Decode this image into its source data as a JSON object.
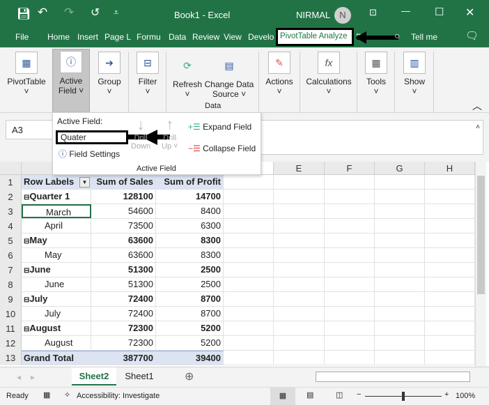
{
  "window": {
    "title": "Book1 - Excel",
    "user": "NIRMAL",
    "avatar": "N"
  },
  "menu_tabs": [
    "File",
    "Home",
    "Insert",
    "Page L",
    "Formu",
    "Data",
    "Review",
    "View",
    "Develo",
    "PivotTable Analyze",
    "D",
    "Tell me"
  ],
  "ribbon": {
    "buttons": [
      {
        "label": "PivotTable",
        "l2": "˅"
      },
      {
        "label": "Active",
        "l2": "Field ˅"
      },
      {
        "label": "Group",
        "l2": "˅"
      },
      {
        "label": "Filter",
        "l2": "˅"
      },
      {
        "label": "Refresh",
        "l2": "˅"
      },
      {
        "label": "Change Data",
        "l2": "Source ˅"
      },
      {
        "label": "Actions",
        "l2": "˅"
      },
      {
        "label": "Calculations",
        "l2": "˅"
      },
      {
        "label": "Tools",
        "l2": "˅"
      },
      {
        "label": "Show",
        "l2": "˅"
      }
    ],
    "group_data": "Data"
  },
  "active_field_panel": {
    "title": "Active Field:",
    "value": "Quater",
    "field_settings": "Field Settings",
    "drill_down": [
      "Drill",
      "Down"
    ],
    "drill_up": [
      "Drill",
      "Up ˅"
    ],
    "expand": "Expand Field",
    "collapse": "Collapse Field",
    "group_label": "Active Field"
  },
  "name_box": "A3",
  "columns": [
    "E",
    "F",
    "G",
    "H"
  ],
  "pivot": {
    "headers": [
      "Row Labels",
      "Sum of Sales",
      "Sum of Profit"
    ],
    "rows": [
      {
        "label": "Quarter 1",
        "sales": "128100",
        "profit": "14700",
        "level": 0
      },
      {
        "label": "March",
        "sales": "54600",
        "profit": "8400",
        "level": 1
      },
      {
        "label": "April",
        "sales": "73500",
        "profit": "6300",
        "level": 1
      },
      {
        "label": "May",
        "sales": "63600",
        "profit": "8300",
        "level": 0
      },
      {
        "label": "May",
        "sales": "63600",
        "profit": "8300",
        "level": 1
      },
      {
        "label": "June",
        "sales": "51300",
        "profit": "2500",
        "level": 0
      },
      {
        "label": "June",
        "sales": "51300",
        "profit": "2500",
        "level": 1
      },
      {
        "label": "July",
        "sales": "72400",
        "profit": "8700",
        "level": 0
      },
      {
        "label": "July",
        "sales": "72400",
        "profit": "8700",
        "level": 1
      },
      {
        "label": "August",
        "sales": "72300",
        "profit": "5200",
        "level": 0
      },
      {
        "label": "August",
        "sales": "72300",
        "profit": "5200",
        "level": 1
      },
      {
        "label": "Grand Total",
        "sales": "387700",
        "profit": "39400",
        "level": 2
      }
    ]
  },
  "sheets": [
    "Sheet2",
    "Sheet1"
  ],
  "status": {
    "ready": "Ready",
    "accessibility": "Accessibility: Investigate",
    "zoom": "100%",
    "zoom_level": 100
  },
  "colors": {
    "brand": "#217346",
    "pivot_header": "#dce3f2"
  }
}
